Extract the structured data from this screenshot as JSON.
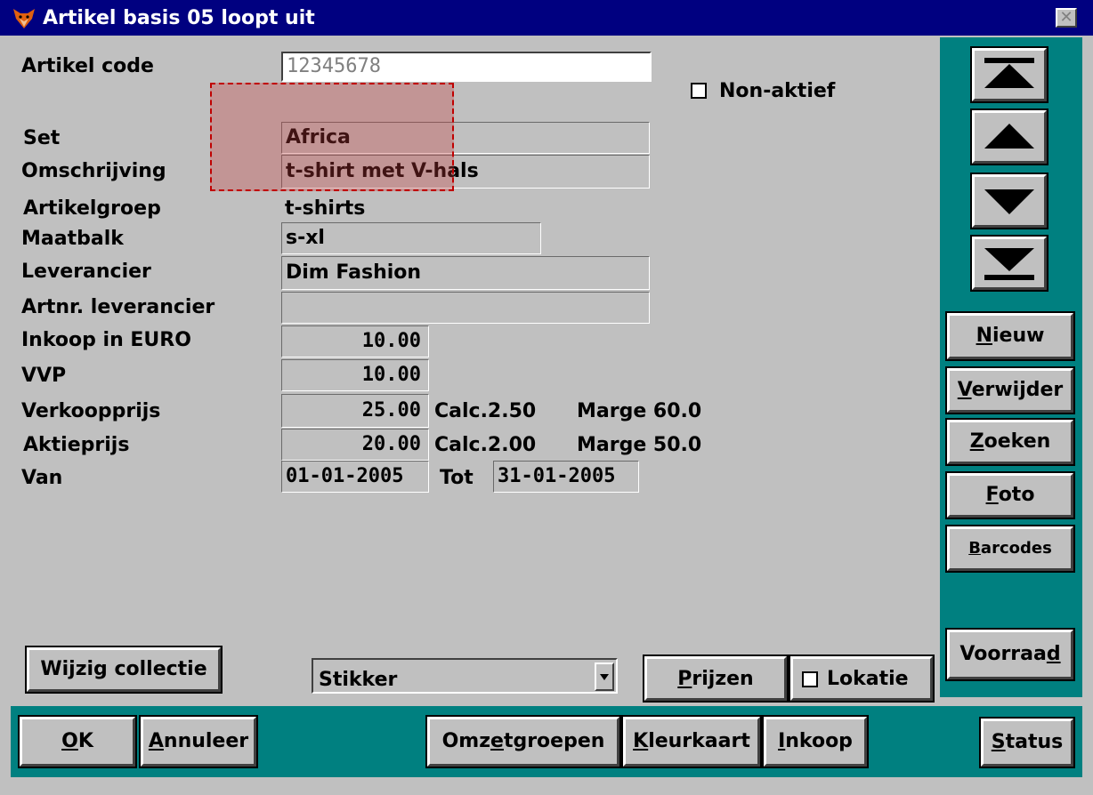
{
  "window": {
    "title": "Artikel basis 05 loopt uit",
    "close_label": "✕"
  },
  "form": {
    "artikel_code_label": "Artikel code",
    "artikel_code_value": "12345678",
    "non_aktief_label": "Non-aktief",
    "set_label": "Set",
    "set_value": "Africa",
    "omschrijving_label": "Omschrijving",
    "omschrijving_value": "t-shirt met V-hals",
    "artikelgroep_label": "Artikelgroep",
    "artikelgroep_value": "t-shirts",
    "maatbalk_label": "Maatbalk",
    "maatbalk_value": "s-xl",
    "leverancier_label": "Leverancier",
    "leverancier_value": "Dim Fashion",
    "artnr_label": "Artnr. leverancier",
    "artnr_value": "",
    "inkoop_label": "Inkoop in EURO",
    "inkoop_value": "10.00",
    "vvp_label": "VVP",
    "vvp_value": "10.00",
    "verkoop_label": "Verkoopprijs",
    "verkoop_value": "25.00",
    "verkoop_calc": "Calc.2.50",
    "verkoop_marge": "Marge 60.0",
    "aktie_label": "Aktieprijs",
    "aktie_value": "20.00",
    "aktie_calc": "Calc.2.00",
    "aktie_marge": "Marge 50.0",
    "van_label": "Van",
    "van_value": "01-01-2005",
    "tot_label": "Tot",
    "tot_value": "31-01-2005"
  },
  "side_buttons": {
    "nieuw": "ieuw",
    "nieuw_key": "N",
    "verwijder": "erwijder",
    "verwijder_key": "V",
    "zoeken": "oeken",
    "zoeken_key": "Z",
    "foto": "oto",
    "foto_key": "F",
    "barcodes": "arcodes",
    "barcodes_key": "B",
    "voorraad_pre": "Voorraa",
    "voorraad_key": "d"
  },
  "bottom": {
    "wijzig_collectie": "Wijzig collectie",
    "stikker_value": "Stikker",
    "prijzen_key": "P",
    "prijzen": "rijzen",
    "lokatie_label": "Lokatie",
    "ok_key": "O",
    "ok": "K",
    "annuleer_key": "A",
    "annuleer": "nnuleer",
    "omzetgroepen_pre": "Omz",
    "omzetgroepen_key": "e",
    "omzetgroepen_post": "tgroepen",
    "kleurkaart_key": "K",
    "kleurkaart": "leurkaart",
    "inkoop_key": "I",
    "inkoop": "nkoop",
    "status_key": "S",
    "status": "tatus"
  },
  "colors": {
    "title_bar": "#000080",
    "panel_teal": "#008080",
    "face": "#c0c0c0"
  },
  "icons": {
    "app": "fox-icon",
    "nav_first": "first-record-icon",
    "nav_prev": "previous-record-icon",
    "nav_next": "next-record-icon",
    "nav_last": "last-record-icon"
  }
}
